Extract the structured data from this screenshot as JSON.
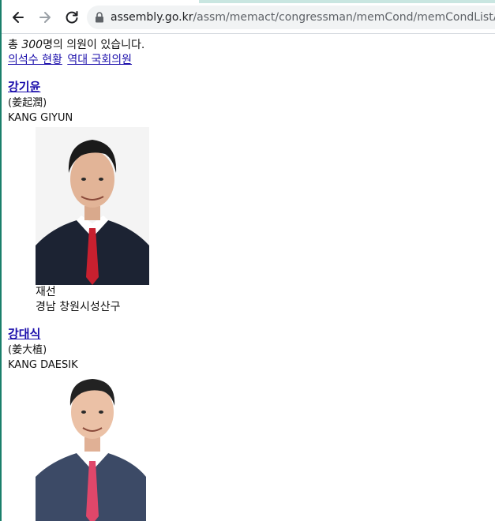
{
  "browser": {
    "url_host": "assembly.go.kr",
    "url_path": "/assm/memact/congressman/memCond/memCondListAjax.do"
  },
  "summary": {
    "prefix": "총 ",
    "count": "300",
    "suffix": "명의 의원이 있습니다."
  },
  "links": [
    "의석수 현황",
    "역대 국회의원"
  ],
  "members": [
    {
      "name": "강기윤",
      "hanja": "(姜起潤)",
      "english": "KANG GIYUN",
      "term": "재선",
      "district": "경남 창원시성산구"
    },
    {
      "name": "강대식",
      "hanja": "(姜大植)",
      "english": "KANG DAESIK"
    }
  ]
}
